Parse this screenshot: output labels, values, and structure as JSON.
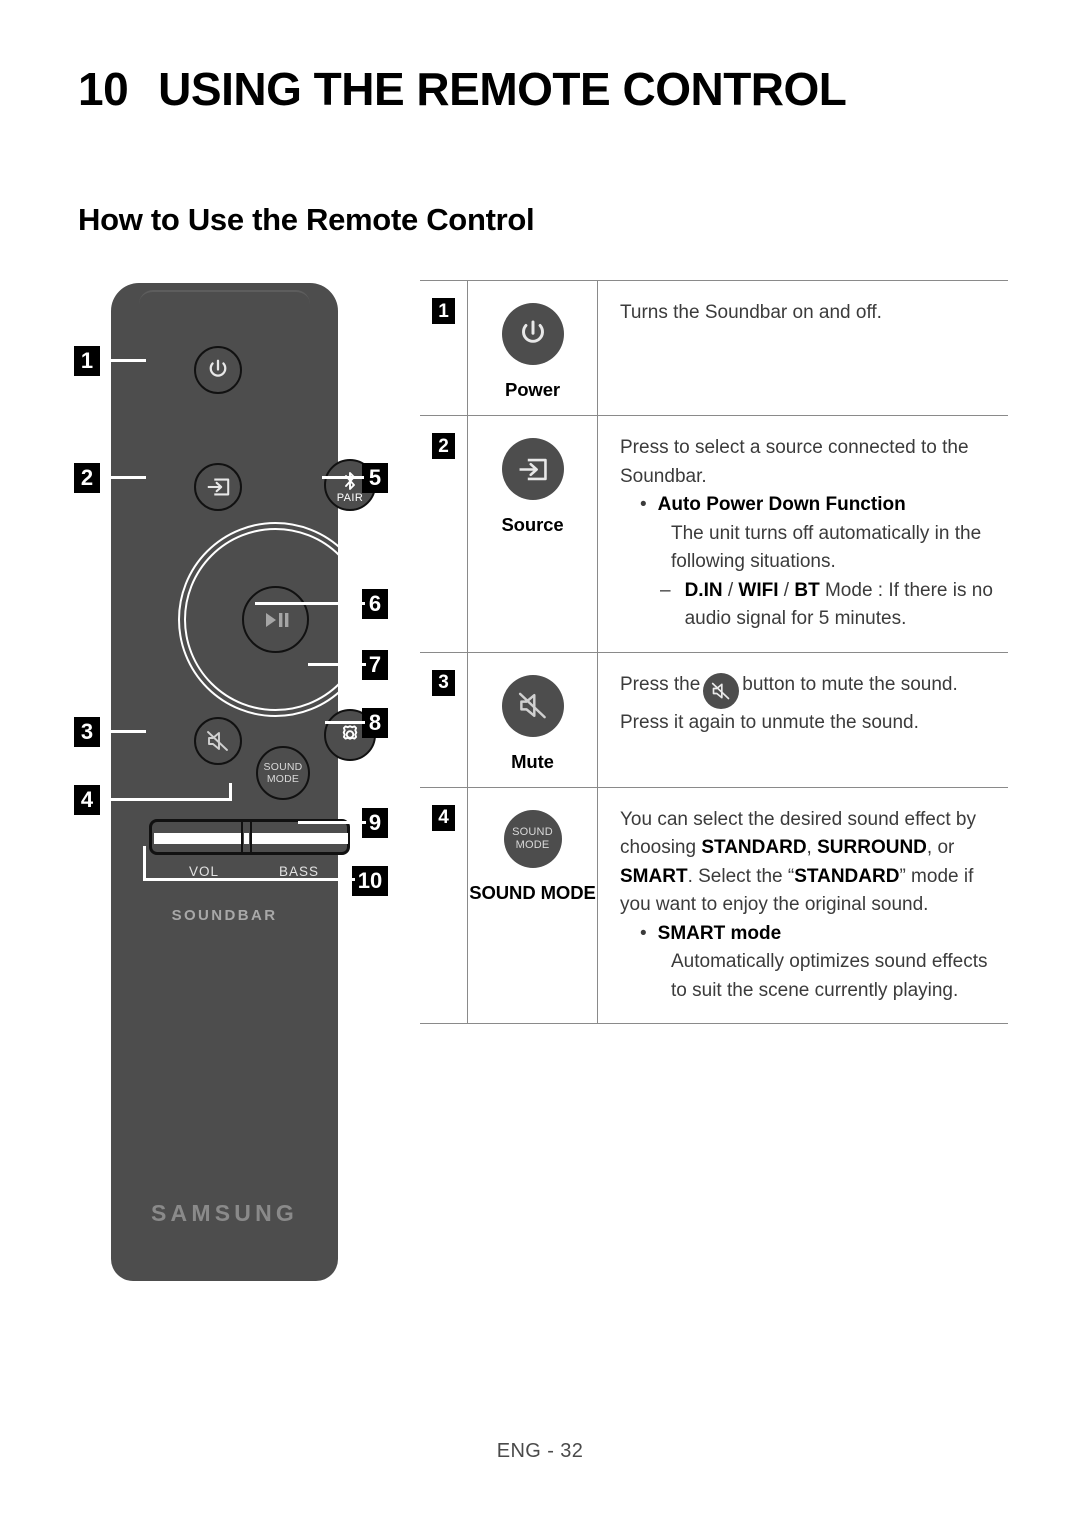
{
  "header": {
    "chapter_number": "10",
    "chapter_title": "USING THE REMOTE CONTROL",
    "section_title": "How to Use the Remote Control"
  },
  "remote": {
    "brand": "SAMSUNG",
    "product_word": "SOUNDBAR",
    "sound_mode_line1": "SOUND",
    "sound_mode_line2": "MODE",
    "pair_label": "PAIR",
    "vol_label": "VOL",
    "bass_label": "BASS",
    "body_color": "#4d4d4d",
    "callouts": [
      {
        "n": "1",
        "target": "power-button"
      },
      {
        "n": "2",
        "target": "source-button"
      },
      {
        "n": "3",
        "target": "mute-button"
      },
      {
        "n": "4",
        "target": "sound-mode-button"
      },
      {
        "n": "5",
        "target": "bluetooth-pair-button"
      },
      {
        "n": "6",
        "target": "play-pause-button"
      },
      {
        "n": "7",
        "target": "navigation-wheel"
      },
      {
        "n": "8",
        "target": "settings-button"
      },
      {
        "n": "9",
        "target": "volume-bass-rocker"
      },
      {
        "n": "10",
        "target": "volume-bass-labels"
      }
    ]
  },
  "table": {
    "rows": [
      {
        "number": "1",
        "button_name": "Power",
        "icon": "power-icon",
        "desc": {
          "line1": "Turns the Soundbar on and off."
        }
      },
      {
        "number": "2",
        "button_name": "Source",
        "icon": "source-input-icon",
        "desc": {
          "line1": "Press to select a source connected to the Soundbar.",
          "bullet1_bold": "Auto Power Down Function",
          "bullet1_body": "The unit turns off automatically in the following situations.",
          "dash1_bold_a": "D.IN",
          "dash1_sep_a": " / ",
          "dash1_bold_b": "WIFI",
          "dash1_sep_b": " / ",
          "dash1_bold_c": "BT",
          "dash1_rest": " Mode : If there is no audio signal for 5 minutes."
        }
      },
      {
        "number": "3",
        "button_name": "Mute",
        "icon": "mute-icon",
        "desc": {
          "pre": "Press the",
          "post": "button to mute the sound.",
          "line2": "Press it again to unmute the sound."
        }
      },
      {
        "number": "4",
        "button_name": "SOUND MODE",
        "icon": "sound-mode-icon",
        "desc": {
          "p1_a": "You can select the desired sound effect by choosing ",
          "p1_b1": "STANDARD",
          "p1_c": ", ",
          "p1_b2": "SURROUND",
          "p1_d": ", or ",
          "p1_b3": "SMART",
          "p1_e": ". Select the “",
          "p1_b4": "STANDARD",
          "p1_f": "” mode if you want to enjoy the original sound.",
          "bullet_bold": "SMART mode",
          "bullet_body": "Automatically optimizes sound effects to suit the scene currently playing."
        }
      }
    ]
  },
  "footer": {
    "page_label": "ENG - 32"
  }
}
